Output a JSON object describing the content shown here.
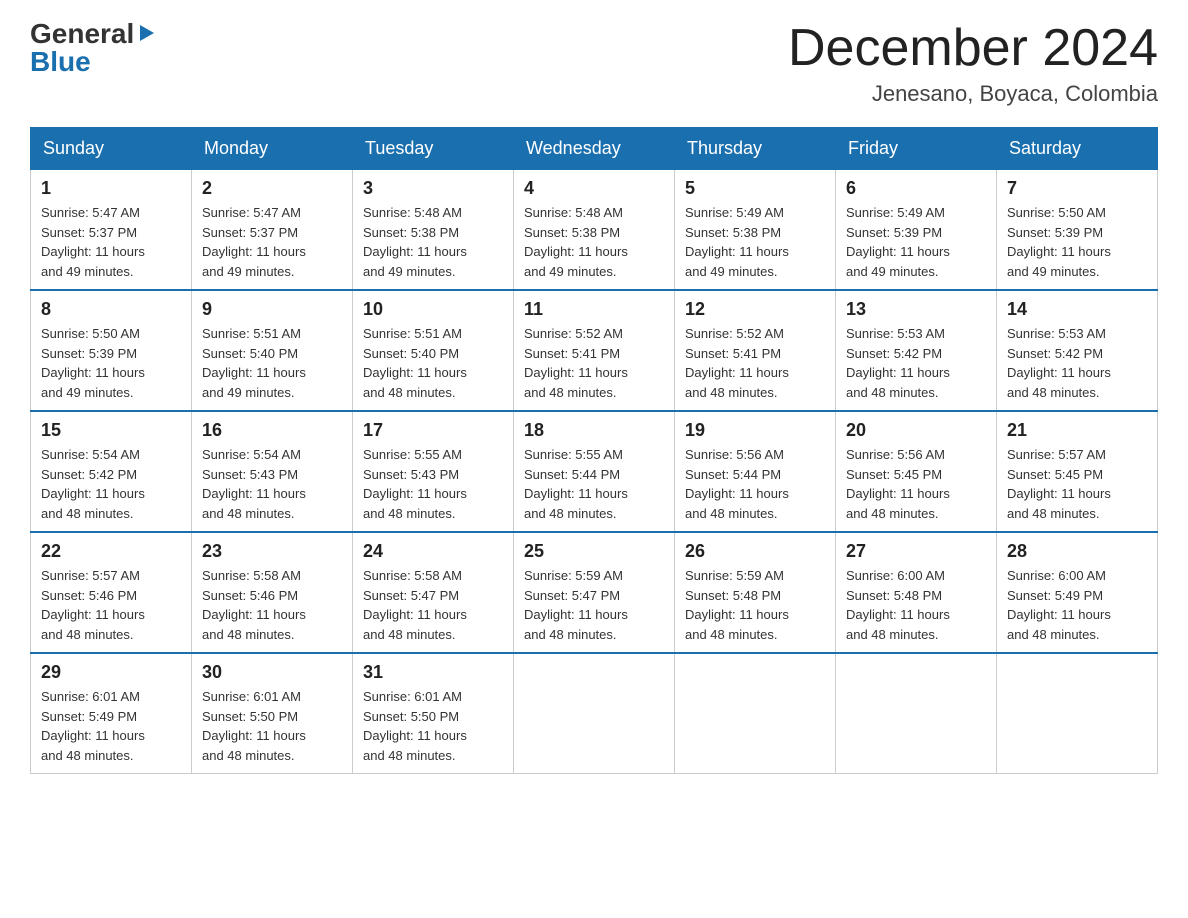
{
  "logo": {
    "general": "General",
    "blue": "Blue",
    "triangle_char": "▶"
  },
  "title": "December 2024",
  "subtitle": "Jenesano, Boyaca, Colombia",
  "days_of_week": [
    "Sunday",
    "Monday",
    "Tuesday",
    "Wednesday",
    "Thursday",
    "Friday",
    "Saturday"
  ],
  "weeks": [
    [
      {
        "day": "1",
        "sunrise": "5:47 AM",
        "sunset": "5:37 PM",
        "daylight": "11 hours and 49 minutes."
      },
      {
        "day": "2",
        "sunrise": "5:47 AM",
        "sunset": "5:37 PM",
        "daylight": "11 hours and 49 minutes."
      },
      {
        "day": "3",
        "sunrise": "5:48 AM",
        "sunset": "5:38 PM",
        "daylight": "11 hours and 49 minutes."
      },
      {
        "day": "4",
        "sunrise": "5:48 AM",
        "sunset": "5:38 PM",
        "daylight": "11 hours and 49 minutes."
      },
      {
        "day": "5",
        "sunrise": "5:49 AM",
        "sunset": "5:38 PM",
        "daylight": "11 hours and 49 minutes."
      },
      {
        "day": "6",
        "sunrise": "5:49 AM",
        "sunset": "5:39 PM",
        "daylight": "11 hours and 49 minutes."
      },
      {
        "day": "7",
        "sunrise": "5:50 AM",
        "sunset": "5:39 PM",
        "daylight": "11 hours and 49 minutes."
      }
    ],
    [
      {
        "day": "8",
        "sunrise": "5:50 AM",
        "sunset": "5:39 PM",
        "daylight": "11 hours and 49 minutes."
      },
      {
        "day": "9",
        "sunrise": "5:51 AM",
        "sunset": "5:40 PM",
        "daylight": "11 hours and 49 minutes."
      },
      {
        "day": "10",
        "sunrise": "5:51 AM",
        "sunset": "5:40 PM",
        "daylight": "11 hours and 48 minutes."
      },
      {
        "day": "11",
        "sunrise": "5:52 AM",
        "sunset": "5:41 PM",
        "daylight": "11 hours and 48 minutes."
      },
      {
        "day": "12",
        "sunrise": "5:52 AM",
        "sunset": "5:41 PM",
        "daylight": "11 hours and 48 minutes."
      },
      {
        "day": "13",
        "sunrise": "5:53 AM",
        "sunset": "5:42 PM",
        "daylight": "11 hours and 48 minutes."
      },
      {
        "day": "14",
        "sunrise": "5:53 AM",
        "sunset": "5:42 PM",
        "daylight": "11 hours and 48 minutes."
      }
    ],
    [
      {
        "day": "15",
        "sunrise": "5:54 AM",
        "sunset": "5:42 PM",
        "daylight": "11 hours and 48 minutes."
      },
      {
        "day": "16",
        "sunrise": "5:54 AM",
        "sunset": "5:43 PM",
        "daylight": "11 hours and 48 minutes."
      },
      {
        "day": "17",
        "sunrise": "5:55 AM",
        "sunset": "5:43 PM",
        "daylight": "11 hours and 48 minutes."
      },
      {
        "day": "18",
        "sunrise": "5:55 AM",
        "sunset": "5:44 PM",
        "daylight": "11 hours and 48 minutes."
      },
      {
        "day": "19",
        "sunrise": "5:56 AM",
        "sunset": "5:44 PM",
        "daylight": "11 hours and 48 minutes."
      },
      {
        "day": "20",
        "sunrise": "5:56 AM",
        "sunset": "5:45 PM",
        "daylight": "11 hours and 48 minutes."
      },
      {
        "day": "21",
        "sunrise": "5:57 AM",
        "sunset": "5:45 PM",
        "daylight": "11 hours and 48 minutes."
      }
    ],
    [
      {
        "day": "22",
        "sunrise": "5:57 AM",
        "sunset": "5:46 PM",
        "daylight": "11 hours and 48 minutes."
      },
      {
        "day": "23",
        "sunrise": "5:58 AM",
        "sunset": "5:46 PM",
        "daylight": "11 hours and 48 minutes."
      },
      {
        "day": "24",
        "sunrise": "5:58 AM",
        "sunset": "5:47 PM",
        "daylight": "11 hours and 48 minutes."
      },
      {
        "day": "25",
        "sunrise": "5:59 AM",
        "sunset": "5:47 PM",
        "daylight": "11 hours and 48 minutes."
      },
      {
        "day": "26",
        "sunrise": "5:59 AM",
        "sunset": "5:48 PM",
        "daylight": "11 hours and 48 minutes."
      },
      {
        "day": "27",
        "sunrise": "6:00 AM",
        "sunset": "5:48 PM",
        "daylight": "11 hours and 48 minutes."
      },
      {
        "day": "28",
        "sunrise": "6:00 AM",
        "sunset": "5:49 PM",
        "daylight": "11 hours and 48 minutes."
      }
    ],
    [
      {
        "day": "29",
        "sunrise": "6:01 AM",
        "sunset": "5:49 PM",
        "daylight": "11 hours and 48 minutes."
      },
      {
        "day": "30",
        "sunrise": "6:01 AM",
        "sunset": "5:50 PM",
        "daylight": "11 hours and 48 minutes."
      },
      {
        "day": "31",
        "sunrise": "6:01 AM",
        "sunset": "5:50 PM",
        "daylight": "11 hours and 48 minutes."
      },
      null,
      null,
      null,
      null
    ]
  ],
  "labels": {
    "sunrise": "Sunrise:",
    "sunset": "Sunset:",
    "daylight": "Daylight:"
  }
}
